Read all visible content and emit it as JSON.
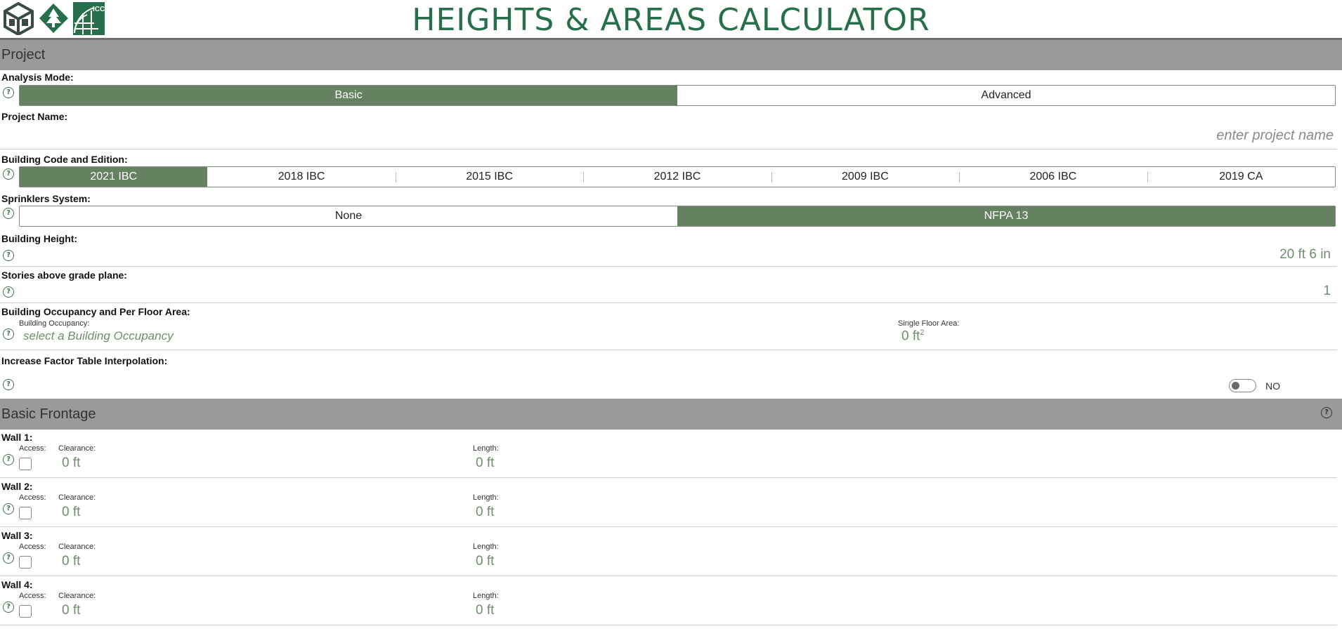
{
  "header": {
    "title": "HEIGHTS & AREAS CALCULATOR",
    "logos": [
      "cube-logo-icon",
      "tree-logo-icon",
      "icc-globe-logo-icon"
    ],
    "icc_text": "ICC"
  },
  "colors": {
    "brand_green": "#266f4a",
    "selected_green": "#658260",
    "section_gray": "#9a9a9a",
    "value_green": "#6f8f6c"
  },
  "project": {
    "section_title": "Project",
    "analysis_mode": {
      "label": "Analysis Mode:",
      "options": [
        "Basic",
        "Advanced"
      ],
      "selected": "Basic"
    },
    "project_name": {
      "label": "Project Name:",
      "placeholder": "enter project name",
      "value": ""
    },
    "building_code": {
      "label": "Building Code and Edition:",
      "options": [
        "2021 IBC",
        "2018 IBC",
        "2015 IBC",
        "2012 IBC",
        "2009 IBC",
        "2006 IBC",
        "2019 CA"
      ],
      "selected": "2021 IBC"
    },
    "sprinklers": {
      "label": "Sprinklers System:",
      "options": [
        "None",
        "NFPA 13"
      ],
      "selected": "NFPA 13"
    },
    "building_height": {
      "label": "Building Height:",
      "value": "20 ft 6 in"
    },
    "stories": {
      "label": "Stories above grade plane:",
      "value": "1"
    },
    "occupancy": {
      "label": "Building Occupancy and Per Floor Area:",
      "occupancy_label": "Building Occupancy:",
      "occupancy_placeholder": "select a Building Occupancy",
      "area_label": "Single Floor Area:",
      "area_value": "0 ft",
      "area_unit_sup": "2"
    },
    "interpolation": {
      "label": "Increase Factor Table Interpolation:",
      "toggle_state": "NO",
      "enabled": false
    }
  },
  "frontage": {
    "section_title": "Basic Frontage",
    "access_label": "Access:",
    "clearance_label": "Clearance:",
    "length_label": "Length:",
    "walls": [
      {
        "label": "Wall 1:",
        "access": false,
        "clearance": "0 ft",
        "length": "0 ft"
      },
      {
        "label": "Wall 2:",
        "access": false,
        "clearance": "0 ft",
        "length": "0 ft"
      },
      {
        "label": "Wall 3:",
        "access": false,
        "clearance": "0 ft",
        "length": "0 ft"
      },
      {
        "label": "Wall 4:",
        "access": false,
        "clearance": "0 ft",
        "length": "0 ft"
      }
    ]
  }
}
